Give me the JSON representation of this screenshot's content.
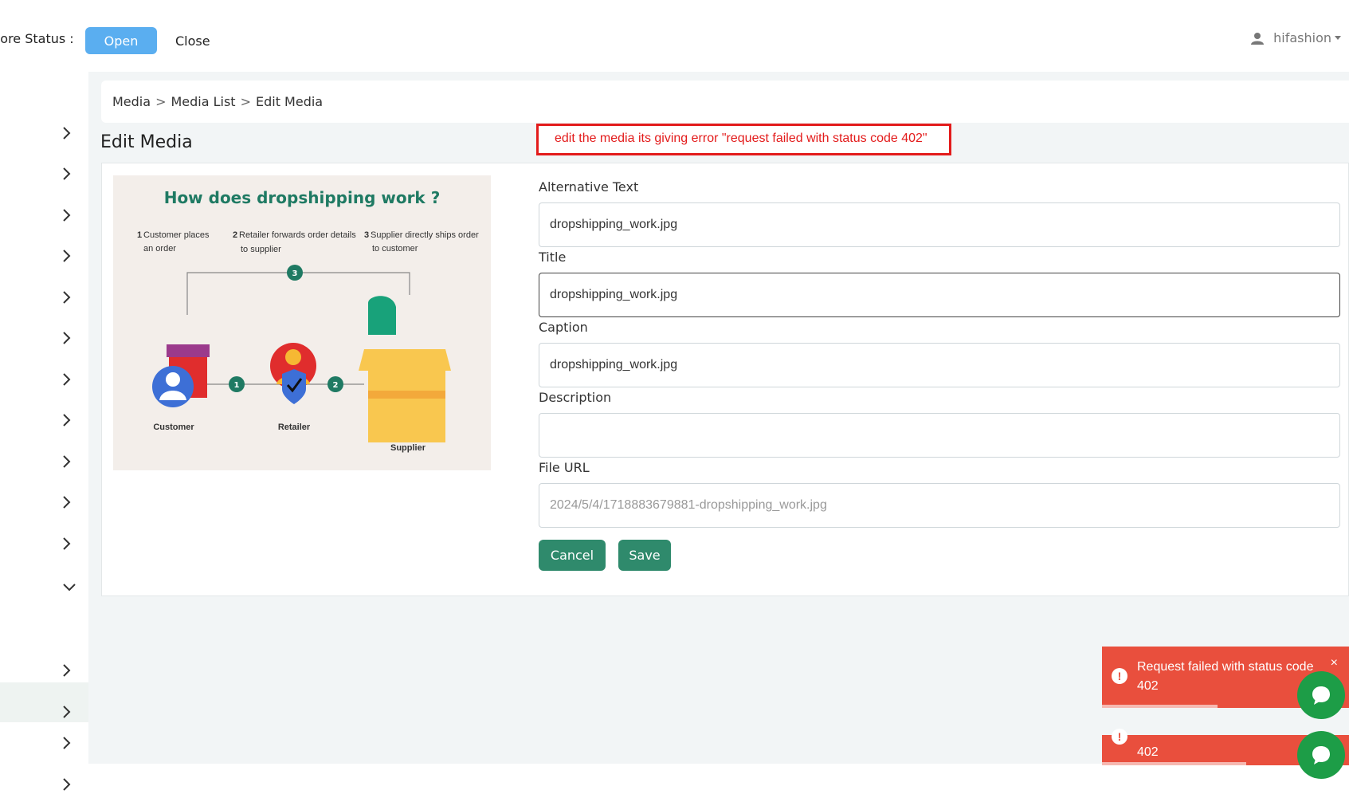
{
  "header": {
    "store_status_label": "tore Status :",
    "open_label": "Open",
    "close_label": "Close",
    "username": "hifashion"
  },
  "breadcrumb": {
    "items": [
      "Media",
      "Media List",
      "Edit Media"
    ],
    "separator": ">"
  },
  "page": {
    "title": "Edit Media"
  },
  "annotation": {
    "text": "edit the media its giving error \"request failed with status code 402\""
  },
  "preview": {
    "heading": "How does dropshipping work ?",
    "steps": [
      {
        "num": "1",
        "line1": "Customer places",
        "line2": "an order"
      },
      {
        "num": "2",
        "line1": "Retailer forwards order details",
        "line2": "to supplier"
      },
      {
        "num": "3",
        "line1": "Supplier directly ships order",
        "line2": "to customer"
      }
    ],
    "labels": {
      "customer": "Customer",
      "retailer": "Retailer",
      "supplier": "Supplier"
    }
  },
  "form": {
    "alt_text": {
      "label": "Alternative Text",
      "value": "dropshipping_work.jpg"
    },
    "title": {
      "label": "Title",
      "value": "dropshipping_work.jpg"
    },
    "caption": {
      "label": "Caption",
      "value": "dropshipping_work.jpg"
    },
    "description": {
      "label": "Description",
      "value": ""
    },
    "file_url": {
      "label": "File URL",
      "value": "2024/5/4/1718883679881-dropshipping_work.jpg"
    },
    "cancel_label": "Cancel",
    "save_label": "Save"
  },
  "toasts": [
    {
      "message": "Request failed with status code 402",
      "close": "×",
      "icon": "exclamation-icon"
    },
    {
      "message": "402",
      "icon": "exclamation-icon"
    }
  ],
  "colors": {
    "open_button": "#5aaef0",
    "primary_green": "#2f8a6c",
    "error_red": "#e94f3d",
    "annotation_red": "#e31b1b",
    "chat_green": "#1d9d47"
  }
}
